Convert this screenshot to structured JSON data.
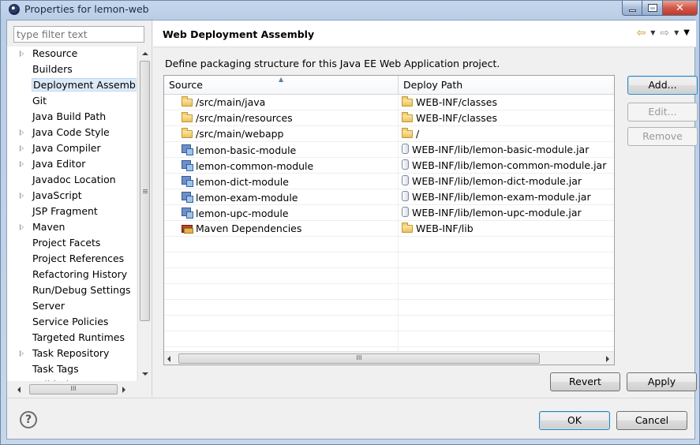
{
  "window": {
    "title": "Properties for lemon-web",
    "close_symbol": "✕"
  },
  "filter": {
    "placeholder": "type filter text"
  },
  "tree": {
    "items": [
      {
        "label": "Resource",
        "expandable": true
      },
      {
        "label": "Builders",
        "expandable": false
      },
      {
        "label": "Deployment Assembly",
        "expandable": false,
        "selected": true
      },
      {
        "label": "Git",
        "expandable": false
      },
      {
        "label": "Java Build Path",
        "expandable": false
      },
      {
        "label": "Java Code Style",
        "expandable": true
      },
      {
        "label": "Java Compiler",
        "expandable": true
      },
      {
        "label": "Java Editor",
        "expandable": true
      },
      {
        "label": "Javadoc Location",
        "expandable": false
      },
      {
        "label": "JavaScript",
        "expandable": true
      },
      {
        "label": "JSP Fragment",
        "expandable": false
      },
      {
        "label": "Maven",
        "expandable": true
      },
      {
        "label": "Project Facets",
        "expandable": false
      },
      {
        "label": "Project References",
        "expandable": false
      },
      {
        "label": "Refactoring History",
        "expandable": false
      },
      {
        "label": "Run/Debug Settings",
        "expandable": false
      },
      {
        "label": "Server",
        "expandable": false
      },
      {
        "label": "Service Policies",
        "expandable": false
      },
      {
        "label": "Targeted Runtimes",
        "expandable": false
      },
      {
        "label": "Task Repository",
        "expandable": true
      },
      {
        "label": "Task Tags",
        "expandable": false
      },
      {
        "label": "Validation",
        "expandable": true
      }
    ]
  },
  "page": {
    "title": "Web Deployment Assembly",
    "description": "Define packaging structure for this Java EE Web Application project."
  },
  "table": {
    "headers": {
      "source": "Source",
      "deploy_path": "Deploy Path"
    },
    "rows": [
      {
        "source": "/src/main/java",
        "source_icon": "folder-icon",
        "deploy": "WEB-INF/classes",
        "deploy_icon": "folder-icon"
      },
      {
        "source": "/src/main/resources",
        "source_icon": "folder-icon",
        "deploy": "WEB-INF/classes",
        "deploy_icon": "folder-icon"
      },
      {
        "source": "/src/main/webapp",
        "source_icon": "folder-icon",
        "deploy": "/",
        "deploy_icon": "folder-icon"
      },
      {
        "source": "lemon-basic-module",
        "source_icon": "project-icon",
        "deploy": "WEB-INF/lib/lemon-basic-module.jar",
        "deploy_icon": "jar-icon"
      },
      {
        "source": "lemon-common-module",
        "source_icon": "project-icon",
        "deploy": "WEB-INF/lib/lemon-common-module.jar",
        "deploy_icon": "jar-icon"
      },
      {
        "source": "lemon-dict-module",
        "source_icon": "project-icon",
        "deploy": "WEB-INF/lib/lemon-dict-module.jar",
        "deploy_icon": "jar-icon"
      },
      {
        "source": "lemon-exam-module",
        "source_icon": "project-icon",
        "deploy": "WEB-INF/lib/lemon-exam-module.jar",
        "deploy_icon": "jar-icon"
      },
      {
        "source": "lemon-upc-module",
        "source_icon": "project-icon",
        "deploy": "WEB-INF/lib/lemon-upc-module.jar",
        "deploy_icon": "jar-icon"
      },
      {
        "source": "Maven Dependencies",
        "source_icon": "maven-library-icon",
        "deploy": "WEB-INF/lib",
        "deploy_icon": "folder-icon"
      }
    ]
  },
  "buttons": {
    "add": "Add...",
    "edit": "Edit...",
    "remove": "Remove",
    "revert": "Revert",
    "apply": "Apply",
    "ok": "OK",
    "cancel": "Cancel"
  },
  "scrollbar_grip": "III",
  "help_symbol": "?",
  "colors": {
    "selection": "#dbe9f8",
    "titlebar": "#b9cde6",
    "close_button": "#c03a2b"
  }
}
